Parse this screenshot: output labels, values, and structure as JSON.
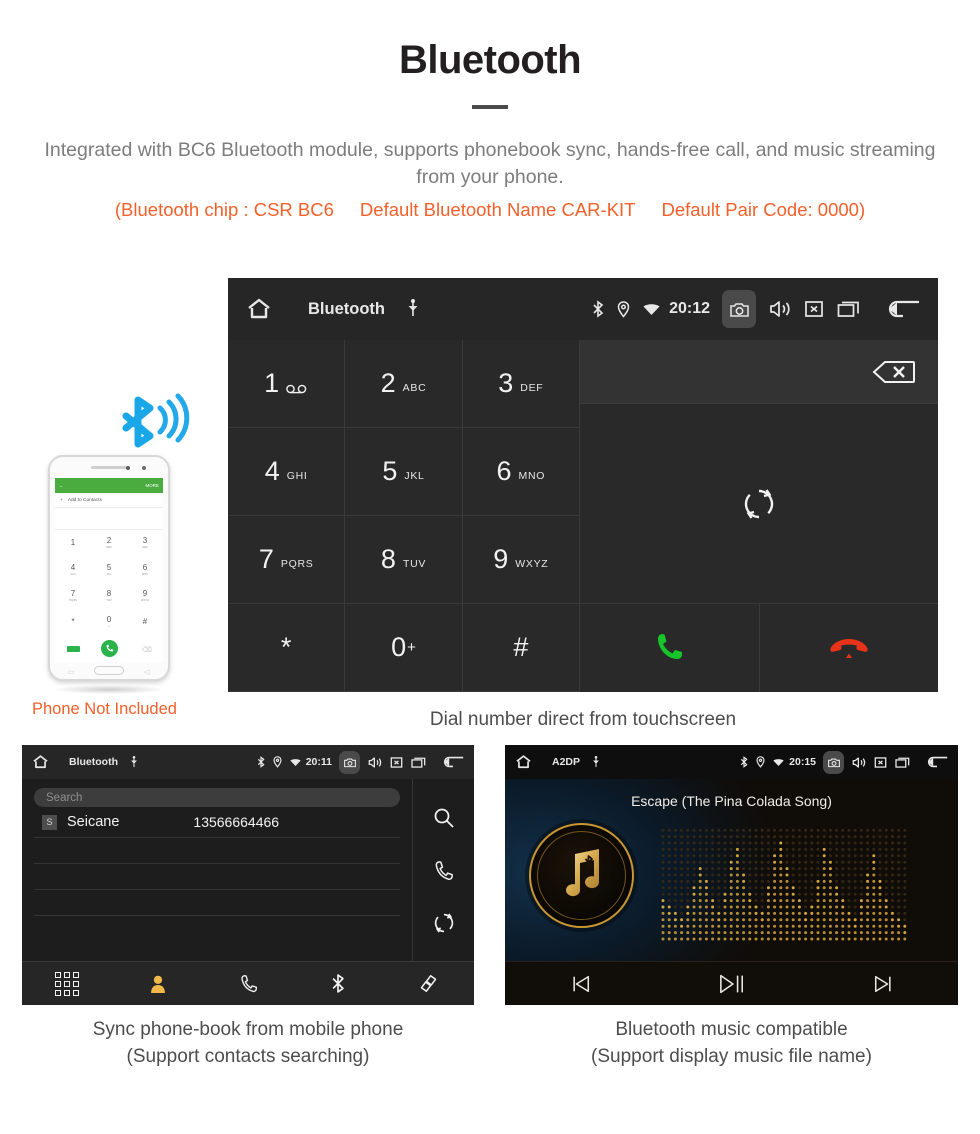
{
  "header": {
    "title": "Bluetooth",
    "description": "Integrated with BC6 Bluetooth module, supports phonebook sync, hands-free call, and music streaming from your phone.",
    "spec_chip": "(Bluetooth chip : CSR BC6",
    "spec_name": "Default Bluetooth Name CAR-KIT",
    "spec_pair": "Default Pair Code: 0000)",
    "accent_color": "#f4602a",
    "text_color": "#7d7d7d"
  },
  "dialer": {
    "statusbar": {
      "title": "Bluetooth",
      "time": "20:12",
      "icons_left": [
        "home-icon",
        "usb-icon"
      ],
      "icons_right": [
        "bluetooth-icon",
        "location-icon",
        "wifi-icon",
        "camera-icon",
        "volume-icon",
        "close-icon",
        "recents-icon",
        "back-icon"
      ]
    },
    "keys": [
      {
        "num": "1",
        "sub": "",
        "glyph": "voicemail"
      },
      {
        "num": "2",
        "sub": "ABC",
        "glyph": ""
      },
      {
        "num": "3",
        "sub": "DEF",
        "glyph": ""
      },
      {
        "num": "4",
        "sub": "GHI",
        "glyph": ""
      },
      {
        "num": "5",
        "sub": "JKL",
        "glyph": ""
      },
      {
        "num": "6",
        "sub": "MNO",
        "glyph": ""
      },
      {
        "num": "7",
        "sub": "PQRS",
        "glyph": ""
      },
      {
        "num": "8",
        "sub": "TUV",
        "glyph": ""
      },
      {
        "num": "9",
        "sub": "WXYZ",
        "glyph": ""
      },
      {
        "num": "*",
        "sub": "",
        "glyph": ""
      },
      {
        "num": "0",
        "sup": "+",
        "sub": "",
        "glyph": ""
      },
      {
        "num": "#",
        "sub": "",
        "glyph": ""
      }
    ],
    "display_value": "",
    "backspace_icon": "backspace-icon",
    "sync_icon": "sync-icon",
    "call_icon": "call-icon",
    "end_call_icon": "end-call-icon",
    "call_color": "#16c529",
    "end_call_color": "#e8321a",
    "tabs": [
      {
        "name": "keypad",
        "icon": "dialpad-icon",
        "active": true
      },
      {
        "name": "contacts",
        "icon": "person-icon",
        "active": false
      },
      {
        "name": "call-log",
        "icon": "handset-icon",
        "active": false
      },
      {
        "name": "bluetooth",
        "icon": "bluetooth-icon",
        "active": false
      },
      {
        "name": "pair",
        "icon": "link-icon",
        "active": false
      }
    ],
    "active_tab_color": "#f0b849",
    "caption": "Dial number direct from touchscreen"
  },
  "phone_mockup": {
    "appbar_back": "←",
    "appbar_more": "MORE",
    "add_contacts": "Add to Contacts",
    "keys": [
      {
        "n": "1",
        "s": ""
      },
      {
        "n": "2",
        "s": "ABC"
      },
      {
        "n": "3",
        "s": "DEF"
      },
      {
        "n": "4",
        "s": "GHI"
      },
      {
        "n": "5",
        "s": "JKL"
      },
      {
        "n": "6",
        "s": "MNO"
      },
      {
        "n": "7",
        "s": "PQRS"
      },
      {
        "n": "8",
        "s": "TUV"
      },
      {
        "n": "9",
        "s": "WXYZ"
      },
      {
        "n": "*",
        "s": ""
      },
      {
        "n": "0",
        "s": "+"
      },
      {
        "n": "#",
        "s": ""
      }
    ],
    "note": "Phone Not Included",
    "note_color": "#f4602a",
    "bluetooth_logo_color": "#1aa7e8"
  },
  "phonebook": {
    "statusbar": {
      "title": "Bluetooth",
      "time": "20:11"
    },
    "search_placeholder": "Search",
    "contacts": [
      {
        "initial": "S",
        "name": "Seicane",
        "number": "13566664466"
      }
    ],
    "rail_icons": [
      "search-icon",
      "handset-icon",
      "sync-icon"
    ],
    "tabs": [
      {
        "name": "keypad",
        "icon": "dialpad-icon",
        "active": false
      },
      {
        "name": "contacts",
        "icon": "person-icon",
        "active": true
      },
      {
        "name": "call-log",
        "icon": "handset-icon",
        "active": false
      },
      {
        "name": "bluetooth",
        "icon": "bluetooth-icon",
        "active": false
      },
      {
        "name": "pair",
        "icon": "link-icon",
        "active": false
      }
    ],
    "caption_line1": "Sync phone-book from mobile phone",
    "caption_line2": "(Support contacts searching)"
  },
  "music": {
    "statusbar": {
      "title": "A2DP",
      "time": "20:15"
    },
    "song_title": "Escape (The Pina Colada Song)",
    "album_icon": "music-note-bluetooth-icon",
    "controls": [
      {
        "name": "previous",
        "icon": "skip-previous-icon"
      },
      {
        "name": "play-pause",
        "icon": "play-pause-icon"
      },
      {
        "name": "next",
        "icon": "skip-next-icon"
      }
    ],
    "accent_color": "#c9962f",
    "caption_line1": "Bluetooth music compatible",
    "caption_line2": "(Support display music file name)"
  }
}
